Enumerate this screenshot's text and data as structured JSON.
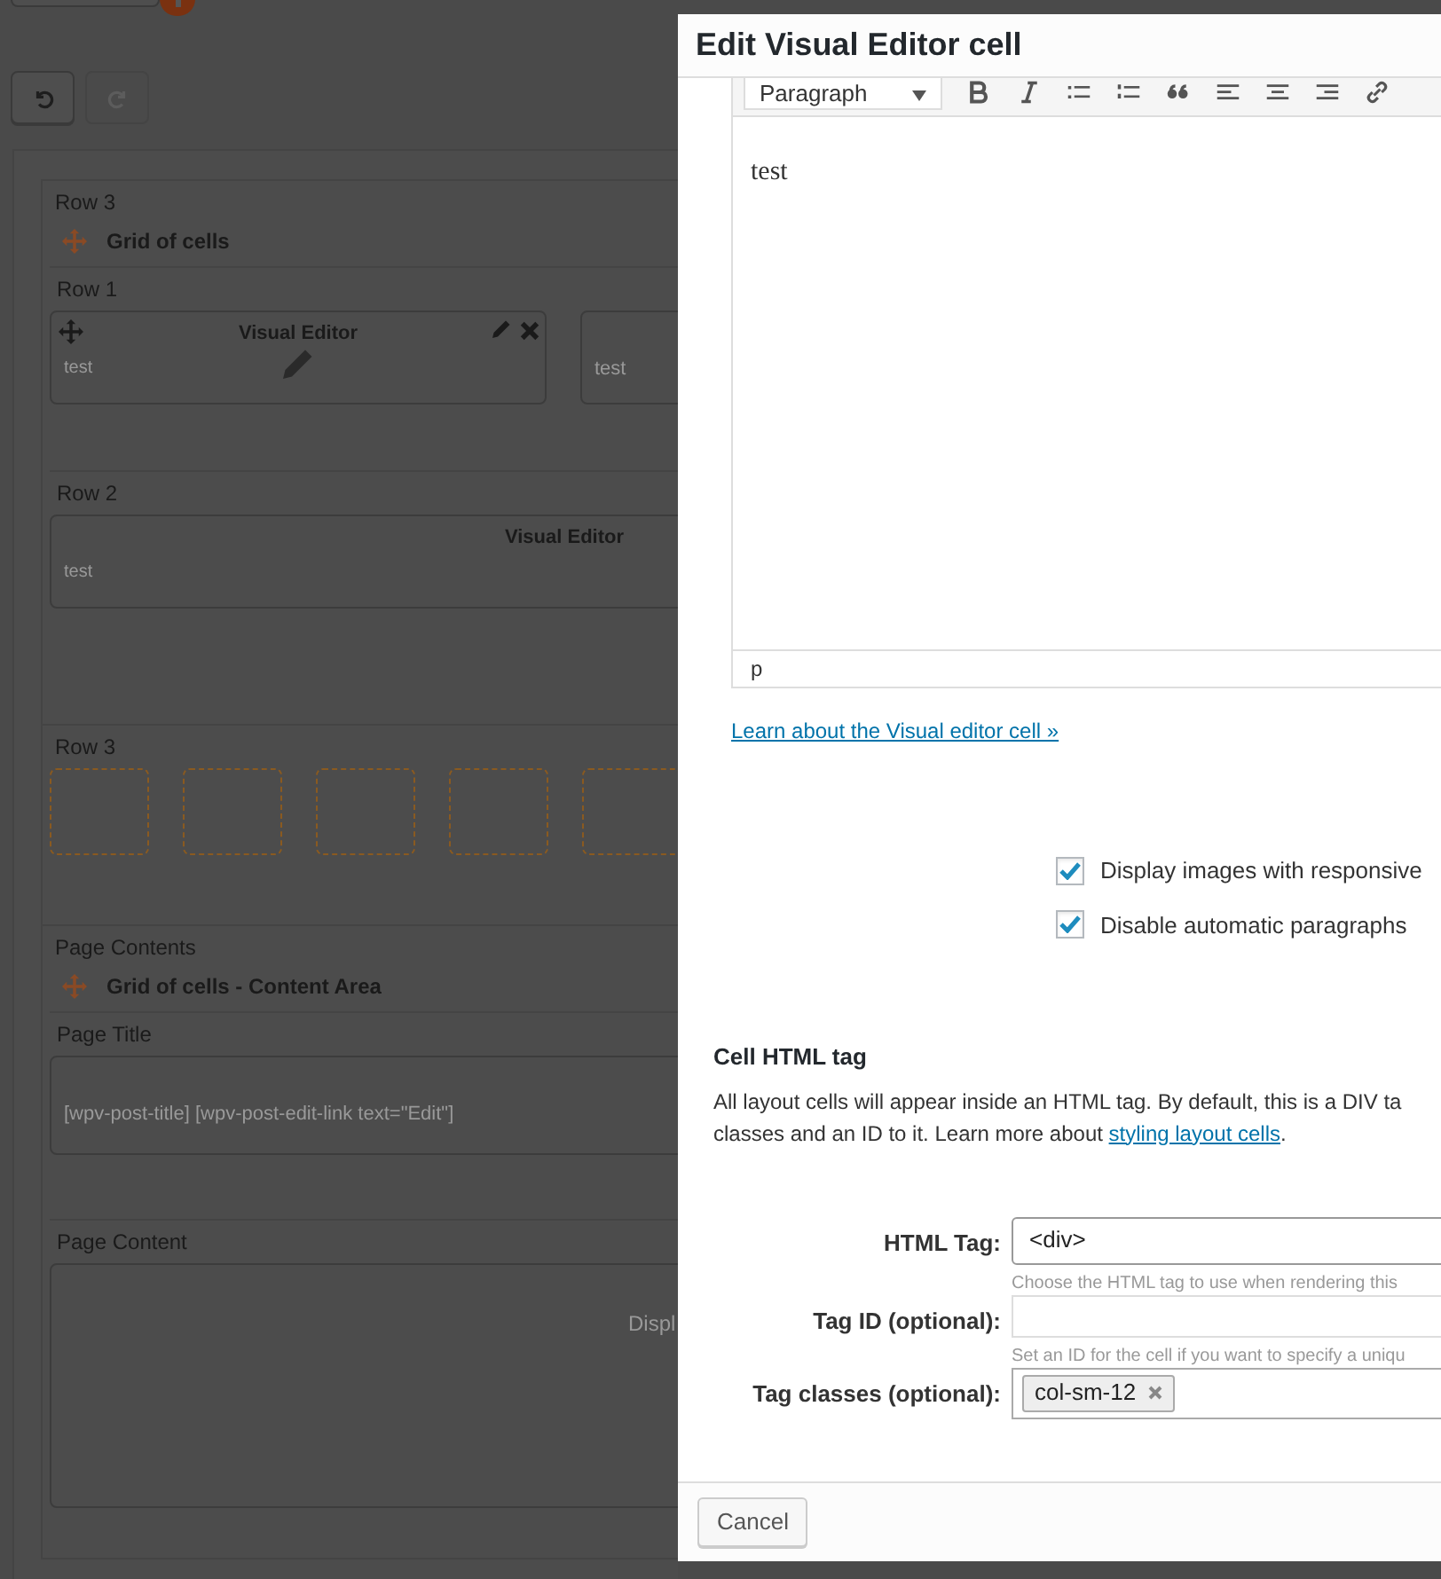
{
  "history_buttons": [
    {
      "kind": "undo",
      "disabled": false
    },
    {
      "kind": "redo",
      "disabled": true
    }
  ],
  "layout_rows": [
    {
      "title": "Row 3",
      "kind": "grid",
      "grid_title": "Grid of cells",
      "rows": [
        {
          "title": "Row 1",
          "cells": [
            {
              "kind": "active",
              "title": "Visual Editor",
              "text": "test"
            },
            {
              "kind": "plain",
              "text": "test"
            }
          ]
        },
        {
          "title": "Row 2",
          "cells": [
            {
              "kind": "plain",
              "title": "Visual Editor",
              "text": "test"
            }
          ]
        }
      ]
    },
    {
      "title": "Row 3",
      "kind": "cells",
      "cells": [
        {
          "kind": "slot"
        },
        {
          "kind": "slot"
        },
        {
          "kind": "slot"
        },
        {
          "kind": "slot"
        },
        {
          "kind": "slot"
        }
      ]
    },
    {
      "title": "Page Contents",
      "kind": "grid",
      "grid_title": "Grid of cells - Content Area",
      "rows": [
        {
          "title": "Page Title",
          "cells": [
            {
              "kind": "plain",
              "text": "[wpv-post-title] [wpv-post-edit-link text=\"Edit\"]"
            }
          ]
        },
        {
          "title": "Page Content",
          "cells": [
            {
              "kind": "note",
              "text": "Displ"
            }
          ]
        }
      ]
    }
  ],
  "dialog": {
    "title": "Edit Visual Editor cell",
    "editor": {
      "format": "Paragraph",
      "tools": [
        {
          "kind": "bold"
        },
        {
          "kind": "italic"
        },
        {
          "kind": "bullets"
        },
        {
          "kind": "numbers"
        },
        {
          "kind": "quote"
        },
        {
          "kind": "align-left"
        },
        {
          "kind": "align-center"
        },
        {
          "kind": "align-right"
        },
        {
          "kind": "link"
        }
      ],
      "content": "test",
      "path": "p"
    },
    "help_link": "Learn about the Visual editor cell »",
    "options": [
      {
        "label": "Display images with responsive",
        "checked": true
      },
      {
        "label": "Disable automatic paragraphs",
        "checked": true
      }
    ],
    "section_title": "Cell HTML tag",
    "description": {
      "lines": [
        "All layout cells will appear inside an HTML tag. By default, this is a DIV ta",
        "classes and an ID to it. Learn more about "
      ],
      "link": "styling layout cells",
      "after": "."
    },
    "fields": [
      {
        "kind": "select",
        "label": "HTML Tag:",
        "value": "<div>",
        "hint": "Choose the HTML tag to use when rendering this"
      },
      {
        "kind": "text",
        "label": "Tag ID (optional):",
        "hint": "Set an ID for the cell if you want to specify a uniqu"
      },
      {
        "kind": "tags",
        "label": "Tag classes (optional):",
        "tags": [
          "col-sm-12"
        ]
      }
    ],
    "buttons": [
      "Cancel"
    ]
  }
}
